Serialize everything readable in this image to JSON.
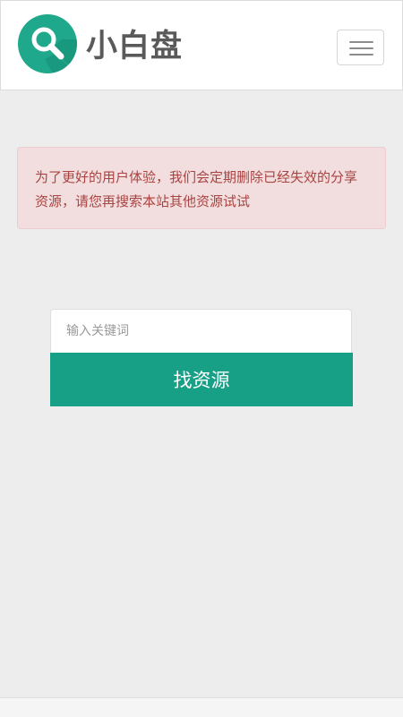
{
  "header": {
    "logo_icon": "search-icon",
    "site_name": "小白盘",
    "menu_icon": "hamburger-menu-icon"
  },
  "alert": {
    "message": "为了更好的用户体验，我们会定期删除已经失效的分享资源，请您再搜索本站其他资源试试"
  },
  "search": {
    "placeholder": "输入关键词",
    "value": "",
    "button_label": "找资源"
  },
  "colors": {
    "accent": "#17a085",
    "alert_background": "#f2dede",
    "alert_text": "#a94442",
    "page_background": "#ededed"
  }
}
